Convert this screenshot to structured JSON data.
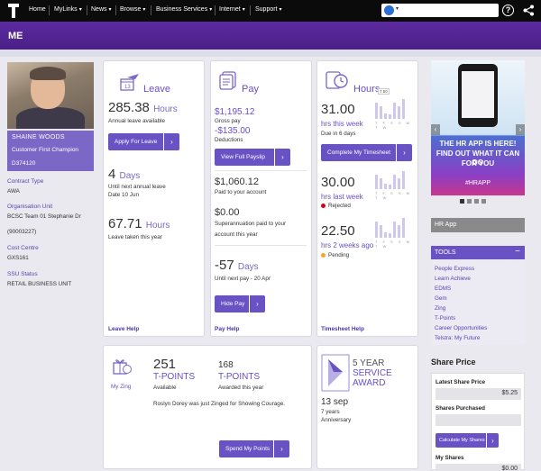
{
  "nav": {
    "items": [
      "Home",
      "MyLinks",
      "News",
      "Browse",
      "Business Services",
      "Internet",
      "Support"
    ],
    "search_placeholder": ""
  },
  "page": {
    "title": "ME"
  },
  "profile": {
    "name": "SHAINE WOODS",
    "role": "Customer First Champion",
    "id": "D374120",
    "contract_label": "Contract Type",
    "contract_value": "AWA",
    "org_label": "Organisation Unit",
    "org_value": "BCSC Team 01 Stephanie Dr",
    "org_code": "(90003227)",
    "cost_label": "Cost Centre",
    "cost_value": "GXS161",
    "ssu_label": "SSU Status",
    "ssu_value": "RETAIL BUSINESS UNIT"
  },
  "leave": {
    "title": "Leave",
    "hours_value": "285.38",
    "hours_unit": "Hours",
    "hours_caption": "Annual leave available",
    "apply_btn": "Apply For Leave",
    "days_value": "4",
    "days_unit": "Days",
    "days_caption1": "Until next annual leave",
    "days_caption2": "Date 10 Jun",
    "taken_value": "67.71",
    "taken_unit": "Hours",
    "taken_caption": "Leave taken this year",
    "help": "Leave Help"
  },
  "pay": {
    "title": "Pay",
    "gross": "$1,195.12",
    "gross_label": "Gross pay",
    "deductions": "-$135.00",
    "deductions_label": "Deductions",
    "payslip_btn": "View Full Payslip",
    "account": "$1,060.12",
    "account_label": "Paid to your account",
    "super": "$0.00",
    "super_label1": "Superannuation paid to your",
    "super_label2": "account this year",
    "days_value": "-57",
    "days_unit": "Days",
    "days_label": "Until next pay - 20 Apr",
    "hide_btn": "Hide Pay",
    "help": "Pay Help"
  },
  "hours": {
    "title": "Hours",
    "badge": "7.50",
    "this_week": "31.00",
    "this_week_label": "hrs this week",
    "due": "Due in 6 days",
    "complete_btn": "Complete My Timesheet",
    "last_week": "30.00",
    "last_week_label": "hrs last week",
    "rejected": "Rejected",
    "two_weeks": "22.50",
    "two_weeks_label": "hrs 2 weeks ago",
    "pending": "Pending",
    "week_days": "T F S S M T W",
    "help": "Timesheet Help"
  },
  "zing": {
    "label": "My Zing",
    "available_value": "251",
    "available_unit": "T-POINTS",
    "available_caption": "Available",
    "awarded_value": "168",
    "awarded_unit": "T-POINTS",
    "awarded_caption": "Awarded this year",
    "message": "Roslyn Dorey was just Zinged for Showing Courage.",
    "spend_btn": "Spend My Points"
  },
  "award": {
    "line1": "5 YEAR",
    "line2": "SERVICE",
    "line3": "AWARD",
    "date": "13 sep",
    "years": "7 years",
    "anniversary": "Anniversary"
  },
  "ad": {
    "text1": "THE HR APP IS HERE!",
    "text2": "FIND OUT WHAT IT CAN DO",
    "text3": "FOR YOU",
    "tag": "#HRAPP"
  },
  "hrapp": "HR App",
  "tools": {
    "title": "TOOLS",
    "items": [
      "People Express",
      "Learn Achieve",
      "EDMS",
      "Gem",
      "Zing",
      "T-Points",
      "Career Opportunities",
      "Telstra: My Future"
    ]
  },
  "shares": {
    "title": "Share Price",
    "latest_label": "Latest Share Price",
    "latest_value": "$5.25",
    "purchased_label": "Shares Purchased",
    "purchased_value": "",
    "calc_btn": "Calculate My Shares",
    "my_shares_label": "My Shares",
    "my_shares_value": "$0.00"
  },
  "colors": {
    "accent": "#6952c4",
    "header": "#4a1f88"
  }
}
